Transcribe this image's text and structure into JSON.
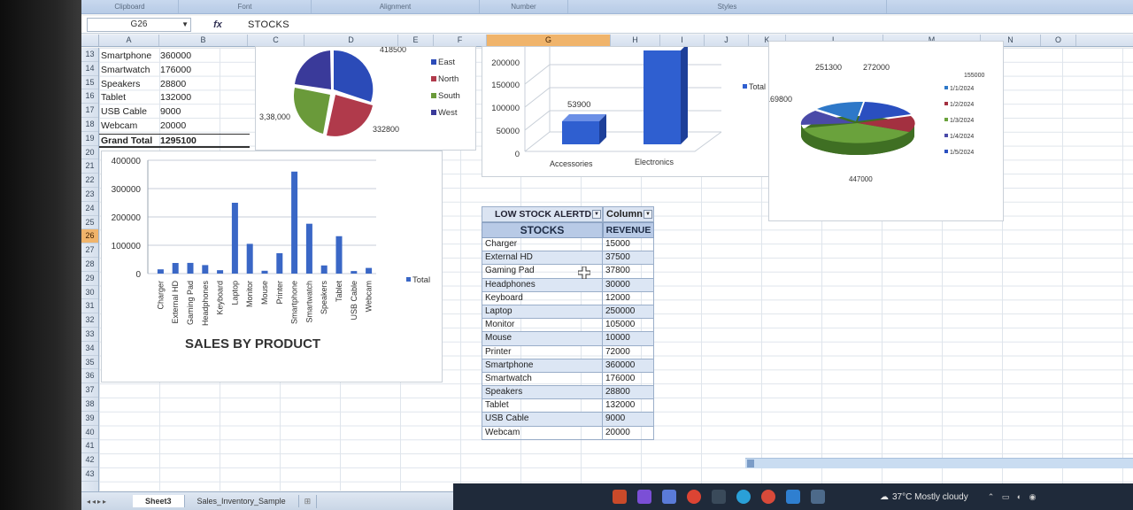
{
  "ribbon": {
    "groups": [
      "Clipboard",
      "Font",
      "Alignment",
      "Number",
      "Styles"
    ]
  },
  "formula_bar": {
    "name_box": "G26",
    "fx": "fx",
    "content": "STOCKS"
  },
  "columns": [
    "A",
    "B",
    "C",
    "D",
    "E",
    "F",
    "G",
    "H",
    "I",
    "J",
    "K",
    "L",
    "M",
    "N",
    "O"
  ],
  "selected_column": "G",
  "rows": [
    "13",
    "14",
    "15",
    "16",
    "17",
    "18",
    "19",
    "20",
    "21",
    "22",
    "23",
    "24",
    "25",
    "26",
    "27",
    "28",
    "29",
    "30",
    "31",
    "32",
    "33",
    "34",
    "35",
    "36",
    "37",
    "38",
    "39",
    "40",
    "41",
    "42",
    "43"
  ],
  "selected_row": "26",
  "data_rows": [
    {
      "product": "Smartphone",
      "value": "360000"
    },
    {
      "product": "Smartwatch",
      "value": "176000"
    },
    {
      "product": "Speakers",
      "value": "28800"
    },
    {
      "product": "Tablet",
      "value": "132000"
    },
    {
      "product": "USB Cable",
      "value": "9000"
    },
    {
      "product": "Webcam",
      "value": "20000"
    }
  ],
  "grand_total": {
    "label": "Grand Total",
    "value": "1295100"
  },
  "region_pie": {
    "legend": [
      "East",
      "North",
      "South",
      "West"
    ],
    "labels": [
      "418500",
      "3,38,000",
      "332800"
    ],
    "colors": [
      "#2b4bb8",
      "#b03a4b",
      "#6a9a3a",
      "#3a3a9a"
    ]
  },
  "category_chart": {
    "y_ticks": [
      "200000",
      "150000",
      "100000",
      "50000",
      "0"
    ],
    "categories": [
      "Accessories",
      "Electronics"
    ],
    "data_label": "53900",
    "legend": "Total"
  },
  "date_pie": {
    "labels": [
      "251300",
      "272000",
      "169800",
      "155000",
      "447000"
    ],
    "legend": [
      "1/1/2024",
      "1/2/2024",
      "1/3/2024",
      "1/4/2024",
      "1/5/2024"
    ]
  },
  "sales_chart": {
    "title": "SALES BY PRODUCT",
    "legend": "Total",
    "y_ticks": [
      "400000",
      "300000",
      "200000",
      "100000",
      "0"
    ]
  },
  "chart_data": {
    "type": "bar",
    "title": "SALES BY PRODUCT",
    "xlabel": "",
    "ylabel": "",
    "ylim": [
      0,
      400000
    ],
    "categories": [
      "Charger",
      "External HD",
      "Gaming Pad",
      "Headphones",
      "Keyboard",
      "Laptop",
      "Monitor",
      "Mouse",
      "Printer",
      "Smartphone",
      "Smartwatch",
      "Speakers",
      "Tablet",
      "USB Cable",
      "Webcam"
    ],
    "series": [
      {
        "name": "Total",
        "values": [
          15000,
          37500,
          37800,
          30000,
          12000,
          250000,
          105000,
          10000,
          72000,
          360000,
          176000,
          28800,
          132000,
          9000,
          20000
        ]
      }
    ],
    "legend_position": "right",
    "grid": true
  },
  "pivot": {
    "filter_label": "LOW STOCK ALERTD",
    "column_label": "Column",
    "header_stocks": "STOCKS",
    "header_revenue": "REVENUE",
    "rows": [
      {
        "stock": "Charger",
        "revenue": "15000"
      },
      {
        "stock": "External HD",
        "revenue": "37500"
      },
      {
        "stock": "Gaming Pad",
        "revenue": "37800"
      },
      {
        "stock": "Headphones",
        "revenue": "30000"
      },
      {
        "stock": "Keyboard",
        "revenue": "12000"
      },
      {
        "stock": "Laptop",
        "revenue": "250000"
      },
      {
        "stock": "Monitor",
        "revenue": "105000"
      },
      {
        "stock": "Mouse",
        "revenue": "10000"
      },
      {
        "stock": "Printer",
        "revenue": "72000"
      },
      {
        "stock": "Smartphone",
        "revenue": "360000"
      },
      {
        "stock": "Smartwatch",
        "revenue": "176000"
      },
      {
        "stock": "Speakers",
        "revenue": "28800"
      },
      {
        "stock": "Tablet",
        "revenue": "132000"
      },
      {
        "stock": "USB Cable",
        "revenue": "9000"
      },
      {
        "stock": "Webcam",
        "revenue": "20000"
      }
    ]
  },
  "sheet_tabs": [
    "Sheet3",
    "Sales_Inventory_Sample"
  ],
  "active_sheet": "Sheet3",
  "taskbar": {
    "weather": "37°C  Mostly cloudy"
  }
}
